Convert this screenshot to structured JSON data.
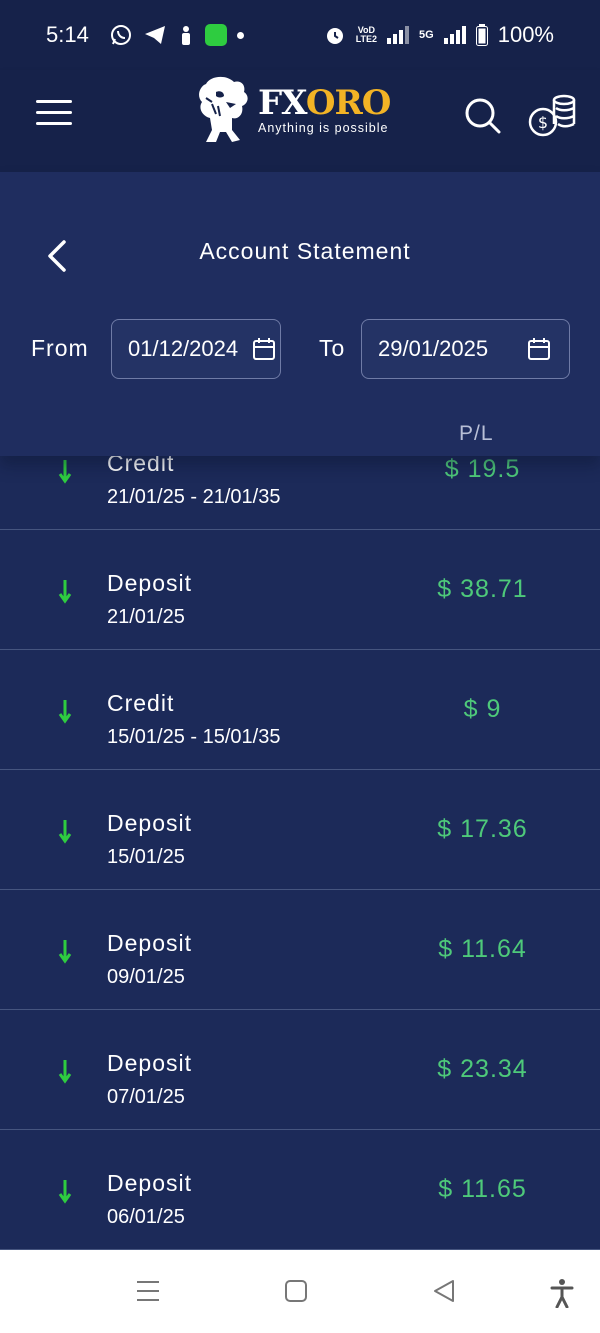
{
  "status_bar": {
    "time": "5:14",
    "vod_line1": "VoD",
    "vod_line2": "LTE2",
    "network": "5G",
    "battery": "100%",
    "icons": [
      "whatsapp-icon",
      "telegram-icon",
      "notification-icon",
      "messages-icon",
      "alarm-icon",
      "signal-icon",
      "battery-icon"
    ]
  },
  "header": {
    "brand_fx": "FX",
    "brand_oro": "ORO",
    "tagline": "Anything is possible",
    "icons": [
      "menu-icon",
      "lion-logo",
      "search-icon",
      "coins-icon"
    ]
  },
  "page": {
    "title": "Account Statement",
    "from_label": "From",
    "to_label": "To",
    "from_date": "01/12/2024",
    "to_date": "29/01/2025",
    "pl_header": "P/L"
  },
  "transactions": [
    {
      "type": "Credit",
      "date": "21/01/25 - 21/01/35",
      "amount": "$ 19.5"
    },
    {
      "type": "Deposit",
      "date": "21/01/25",
      "amount": "$ 38.71"
    },
    {
      "type": "Credit",
      "date": "15/01/25 - 15/01/35",
      "amount": "$ 9"
    },
    {
      "type": "Deposit",
      "date": "15/01/25",
      "amount": "$ 17.36"
    },
    {
      "type": "Deposit",
      "date": "09/01/25",
      "amount": "$ 11.64"
    },
    {
      "type": "Deposit",
      "date": "07/01/25",
      "amount": "$ 23.34"
    },
    {
      "type": "Deposit",
      "date": "06/01/25",
      "amount": "$ 11.65"
    }
  ],
  "colors": {
    "background": "#1c2a59",
    "header": "#16224a",
    "brand_gold": "#f2b325",
    "positive": "#4ec97a",
    "arrow": "#2ecc40"
  },
  "bottom_nav": {
    "icons": [
      "recent-apps-icon",
      "home-icon",
      "back-icon",
      "accessibility-icon"
    ]
  }
}
